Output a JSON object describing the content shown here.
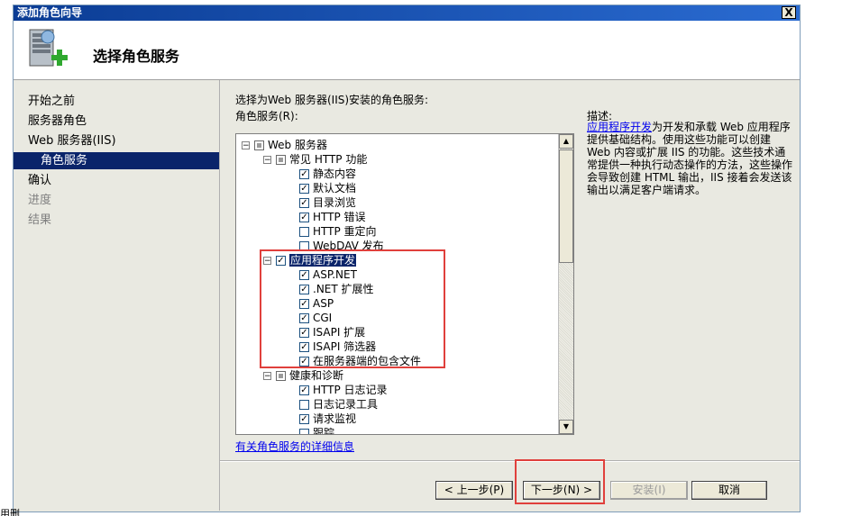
{
  "window": {
    "title": "添加角色向导",
    "close_label": "X"
  },
  "header": {
    "title": "选择角色服务"
  },
  "sidebar": {
    "items": [
      {
        "label": "开始之前"
      },
      {
        "label": "服务器角色"
      },
      {
        "label": "Web 服务器(IIS)"
      },
      {
        "label": "角色服务"
      },
      {
        "label": "确认"
      },
      {
        "label": "进度"
      },
      {
        "label": "结果"
      }
    ]
  },
  "main": {
    "instruction": "选择为Web 服务器(IIS)安装的角色服务:",
    "role_services_label": "角色服务(R):",
    "tree": [
      {
        "label": "Web 服务器",
        "state": "partial"
      },
      {
        "label": "常见 HTTP 功能",
        "state": "partial"
      },
      {
        "label": "静态内容",
        "state": "checked"
      },
      {
        "label": "默认文档",
        "state": "checked"
      },
      {
        "label": "目录浏览",
        "state": "checked"
      },
      {
        "label": "HTTP 错误",
        "state": "checked"
      },
      {
        "label": "HTTP 重定向",
        "state": "unchecked"
      },
      {
        "label": "WebDAV 发布",
        "state": "unchecked"
      },
      {
        "label": "应用程序开发",
        "state": "checked"
      },
      {
        "label": "ASP.NET",
        "state": "checked"
      },
      {
        "label": ".NET 扩展性",
        "state": "checked"
      },
      {
        "label": "ASP",
        "state": "checked"
      },
      {
        "label": "CGI",
        "state": "checked"
      },
      {
        "label": "ISAPI 扩展",
        "state": "checked"
      },
      {
        "label": "ISAPI 筛选器",
        "state": "checked"
      },
      {
        "label": "在服务器端的包含文件",
        "state": "checked"
      },
      {
        "label": "健康和诊断",
        "state": "partial"
      },
      {
        "label": "HTTP 日志记录",
        "state": "checked"
      },
      {
        "label": "日志记录工具",
        "state": "unchecked"
      },
      {
        "label": "请求监视",
        "state": "checked"
      },
      {
        "label": "跟踪",
        "state": "unchecked"
      }
    ],
    "description_label": "描述:",
    "description_link": "应用程序开发",
    "description_text": "为开发和承载 Web 应用程序提供基础结构。使用这些功能可以创建 Web 内容或扩展 IIS 的功能。这些技术通常提供一种执行动态操作的方法，这些操作会导致创建 HTML 输出，IIS 接着会发送该输出以满足客户端请求。",
    "more_info_link": "有关角色服务的详细信息"
  },
  "buttons": {
    "prev": "< 上一步(P)",
    "next": "下一步(N) >",
    "install": "安装(I)",
    "cancel": "取消"
  },
  "bottom_text": "用删"
}
